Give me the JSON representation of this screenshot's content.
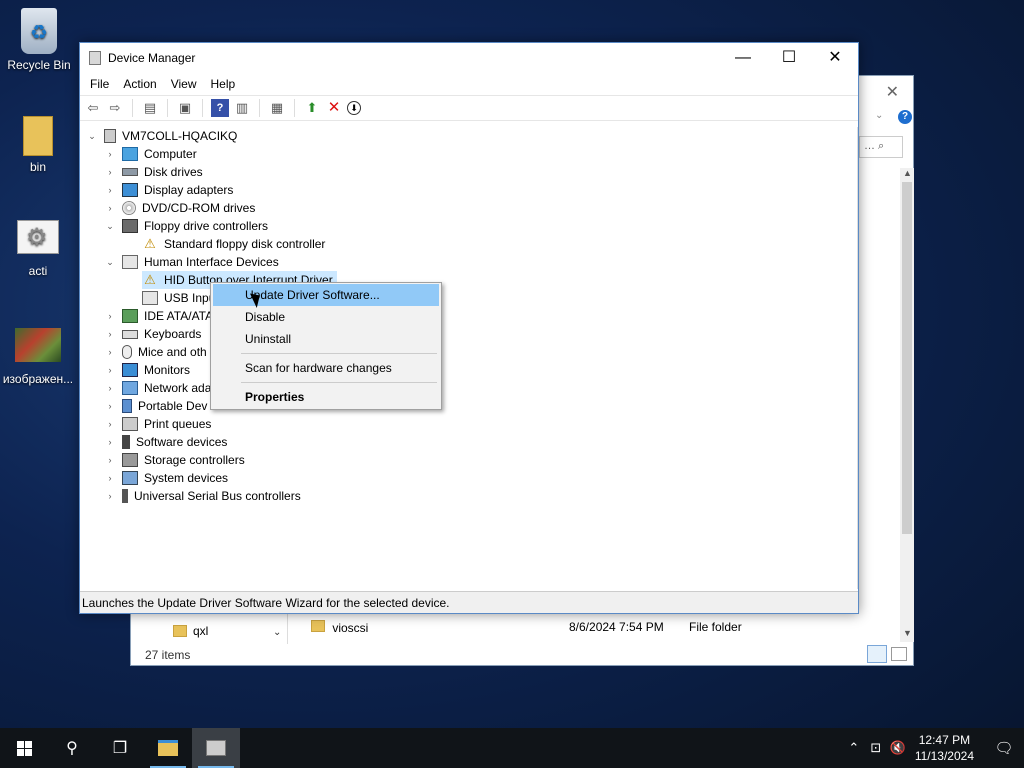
{
  "desktop": {
    "icons": [
      {
        "label": "Recycle Bin"
      },
      {
        "label": "bin"
      },
      {
        "label": "acti"
      },
      {
        "label": "изображен..."
      }
    ]
  },
  "explorer": {
    "nav_item": "qxl",
    "row": {
      "name": "vioscsi",
      "date": "8/6/2024 7:54 PM",
      "type": "File folder"
    },
    "status": "27 items",
    "search_placeholder": "… ⌕"
  },
  "device_manager": {
    "title": "Device Manager",
    "menu": [
      "File",
      "Action",
      "View",
      "Help"
    ],
    "tree": {
      "root": "VM7COLL-HQACIKQ",
      "nodes": [
        {
          "label": "Computer",
          "icon": "computer-icon"
        },
        {
          "label": "Disk drives",
          "icon": "disk-icon"
        },
        {
          "label": "Display adapters",
          "icon": "display-icon"
        },
        {
          "label": "DVD/CD-ROM drives",
          "icon": "dvd-icon"
        },
        {
          "label": "Floppy drive controllers",
          "icon": "floppy-icon",
          "expanded": true,
          "children": [
            "Standard floppy disk controller"
          ]
        },
        {
          "label": "Human Interface Devices",
          "icon": "hid-icon",
          "expanded": true,
          "children": [
            "HID Button over Interrupt Driver",
            "USB Input Device"
          ]
        },
        {
          "label": "IDE ATA/ATAPI controllers",
          "icon": "ide-icon"
        },
        {
          "label": "Keyboards",
          "icon": "keyboard-icon"
        },
        {
          "label": "Mice and other pointing devices",
          "icon": "mouse-icon"
        },
        {
          "label": "Monitors",
          "icon": "monitor-icon"
        },
        {
          "label": "Network adapters",
          "icon": "network-icon"
        },
        {
          "label": "Portable Devices",
          "icon": "portable-icon"
        },
        {
          "label": "Print queues",
          "icon": "print-icon"
        },
        {
          "label": "Software devices",
          "icon": "software-icon"
        },
        {
          "label": "Storage controllers",
          "icon": "storage-icon"
        },
        {
          "label": "System devices",
          "icon": "system-icon"
        },
        {
          "label": "Universal Serial Bus controllers",
          "icon": "usb-icon"
        }
      ]
    },
    "visible_labels": {
      "hid_button": "HID Button over Interrupt Driver",
      "usb_input": "USB Inpu",
      "ide": "IDE ATA/ATA",
      "mice": "Mice and oth",
      "network": "Network ada",
      "portable": "Portable Dev"
    },
    "status": "Launches the Update Driver Software Wizard for the selected device."
  },
  "context_menu": {
    "items": [
      {
        "label": "Update Driver Software...",
        "highlighted": true
      },
      {
        "label": "Disable"
      },
      {
        "label": "Uninstall"
      },
      {
        "label": "Scan for hardware changes"
      },
      {
        "label": "Properties",
        "bold": true
      }
    ]
  },
  "taskbar": {
    "time": "12:47 PM",
    "date": "11/13/2024"
  },
  "colors": {
    "selection": "#cce8ff",
    "menu_highlight": "#91c9f7",
    "taskbar": "#101418"
  }
}
